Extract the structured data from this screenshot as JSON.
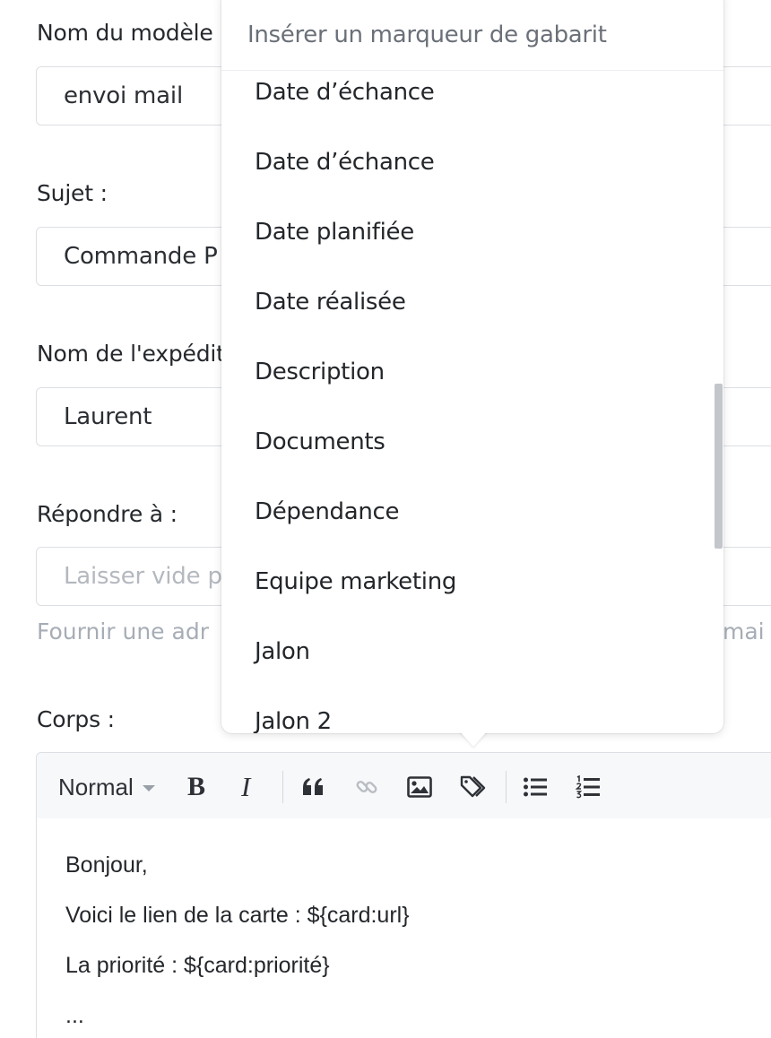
{
  "form": {
    "template_name": {
      "label": "Nom du modèle :",
      "value": "envoi mail"
    },
    "subject": {
      "label": "Sujet :",
      "value": "Commande P"
    },
    "sender_name": {
      "label": "Nom de l'expéditeur :",
      "value": "Laurent"
    },
    "reply_to": {
      "label": "Répondre à :",
      "placeholder": "Laisser vide p",
      "hint": "Fournir une adr",
      "hint_end": "mai"
    },
    "body": {
      "label": "Corps :",
      "toolbar": {
        "format_label": "Normal",
        "bold": "B",
        "italic": "I"
      },
      "lines": [
        "Bonjour,",
        "Voici le lien de la carte : ${card:url}",
        "La priorité : ${card:priorité}",
        "..."
      ]
    }
  },
  "dropdown": {
    "title": "Insérer un marqueur de gabarit",
    "items": [
      "Date d’échance",
      "Date d’échance",
      "Date planifiée",
      "Date réalisée",
      "Description",
      "Documents",
      "Dépendance",
      "Equipe marketing",
      "Jalon",
      "Jalon 2"
    ]
  },
  "icons": {
    "quote": "quote-icon",
    "link": "link-icon",
    "image": "image-icon",
    "tag": "tag-icon",
    "bullet_list": "bullet-list-icon",
    "ordered_list": "ordered-list-icon"
  },
  "colors": {
    "text": "#23262a",
    "muted": "#a7adb6",
    "border": "#dcdfe4",
    "toolbar_bg": "#f7f8fa"
  }
}
